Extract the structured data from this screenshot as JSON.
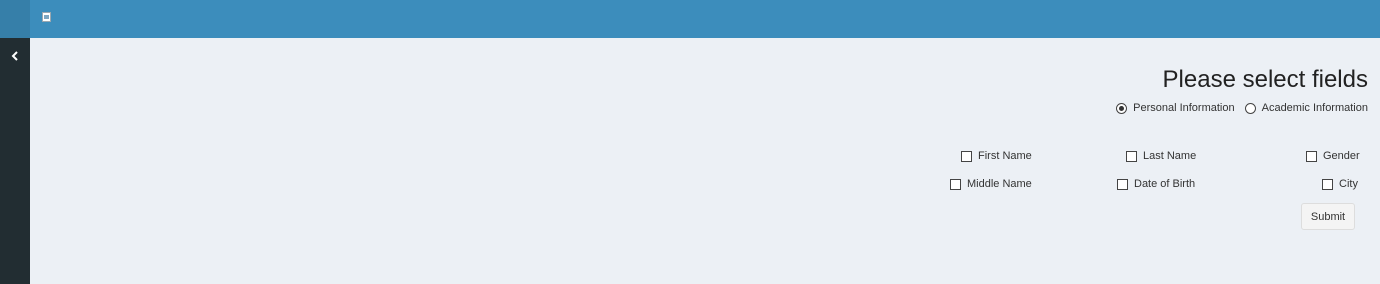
{
  "header": {
    "logo_icon": "broken-image-icon",
    "toggle_icon": "chevron-left-icon"
  },
  "colors": {
    "header": "#3c8dbc",
    "sidebar": "#222d32",
    "content_bg": "#ecf0f5"
  },
  "form": {
    "title": "Please select fields",
    "radios": [
      {
        "label": "Personal Information",
        "checked": true
      },
      {
        "label": "Academic Information",
        "checked": false
      }
    ],
    "checkboxes": [
      {
        "label": "First Name",
        "checked": false
      },
      {
        "label": "Last Name",
        "checked": false
      },
      {
        "label": "Gender",
        "checked": false
      },
      {
        "label": "Middle Name",
        "checked": false
      },
      {
        "label": "Date of Birth",
        "checked": false
      },
      {
        "label": "City",
        "checked": false
      }
    ],
    "submit_label": "Submit"
  }
}
